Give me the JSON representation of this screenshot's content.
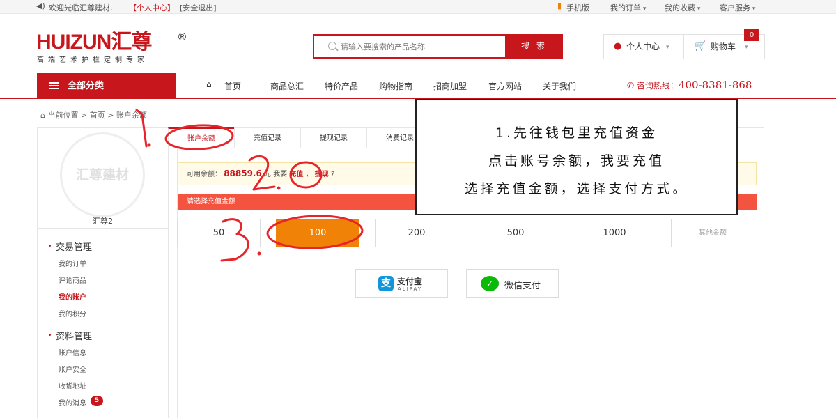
{
  "topbar": {
    "welcome": "欢迎光临汇尊建材,",
    "user_center": "【个人中心】",
    "logout": "[安全退出]",
    "mobile": "手机版",
    "orders": "我的订单",
    "favorites": "我的收藏",
    "service": "客户服务"
  },
  "header": {
    "logo_text": "HUIZUN汇尊",
    "logo_reg": "®",
    "logo_slogan": "高端艺术护栏定制专家",
    "search_placeholder": "请输入要搜索的产品名称",
    "search_button": "搜 索",
    "user_center": "个人中心",
    "cart": "购物车",
    "cart_count": "0"
  },
  "nav": {
    "all_categories": "全部分类",
    "items": [
      "首页",
      "商品总汇",
      "特价产品",
      "购物指南",
      "招商加盟",
      "官方网站",
      "关于我们"
    ],
    "hotline_label": "咨询热线：",
    "hotline_number": "400-8381-868"
  },
  "breadcrumb": {
    "current": "当前位置",
    "home": "首页",
    "page": "账户余额"
  },
  "sidebar": {
    "avatar_text": "汇尊建材",
    "username": "汇尊2",
    "sections": [
      {
        "title": "交易管理",
        "items": [
          "我的订单",
          "评论商品",
          "我的账户",
          "我的积分"
        ]
      },
      {
        "title": "资料管理",
        "items": [
          "账户信息",
          "账户安全",
          "收货地址",
          "我的消息"
        ]
      }
    ],
    "message_count": "5"
  },
  "tabs": [
    "账户余额",
    "充值记录",
    "提现记录",
    "消费记录"
  ],
  "balance": {
    "label": "可用余额：",
    "amount": "88859.6",
    "unit_text": "元 我要",
    "recharge": "充值",
    "withdraw": "提现",
    "question": "?"
  },
  "recharge": {
    "header": "请选择充值金额",
    "amounts": [
      "50",
      "100",
      "200",
      "500",
      "1000"
    ],
    "other": "其他金额",
    "selected": "100"
  },
  "payment": {
    "alipay": "支付宝",
    "alipay_sub": "ALIPAY",
    "wechat": "微信支付"
  },
  "instruction": {
    "line1": "1.先往钱包里充值资金",
    "line2": "点击账号余额，我要充值",
    "line3": "选择充值金额，选择支付方式。"
  },
  "annotations": {
    "step1": "1.",
    "step2": "2.",
    "step3": "3."
  },
  "colors": {
    "brand": "#c8161d",
    "amount_header": "#f3533f",
    "selected_amount": "#f08307",
    "alipay": "#1296db",
    "wechat": "#09bb07",
    "annotation": "#e8242b"
  }
}
